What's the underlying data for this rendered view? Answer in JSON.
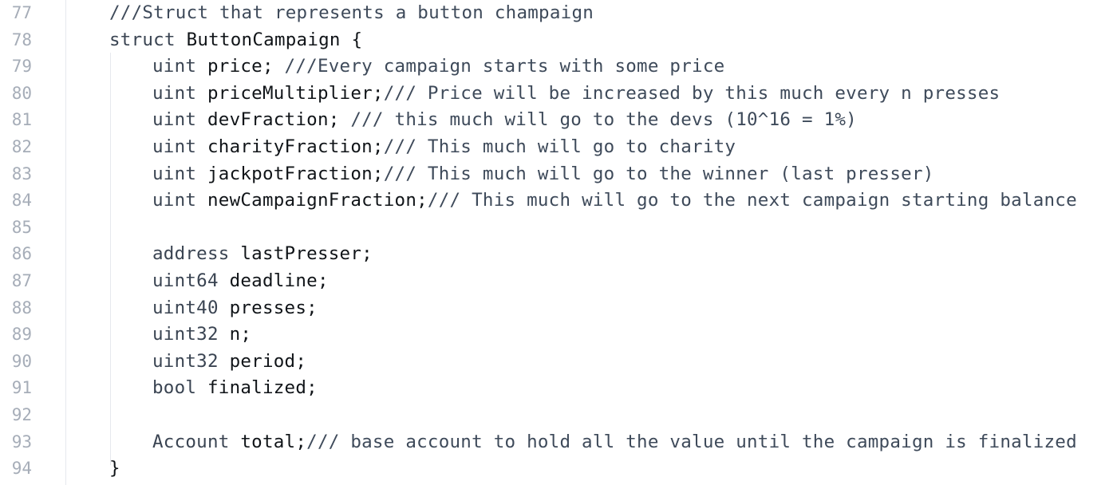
{
  "editor": {
    "lines": [
      {
        "num": "77",
        "indent": 0,
        "type": "",
        "name": "",
        "comment": "///Struct that represents a button champaign"
      },
      {
        "num": "78",
        "indent": 0,
        "type": "struct",
        "name": "ButtonCampaign {",
        "comment": ""
      },
      {
        "num": "79",
        "indent": 1,
        "type": "uint",
        "name": "price;",
        "comment": " ///Every campaign starts with some price"
      },
      {
        "num": "80",
        "indent": 1,
        "type": "uint",
        "name": "priceMultiplier;",
        "comment": "/// Price will be increased by this much every n presses"
      },
      {
        "num": "81",
        "indent": 1,
        "type": "uint",
        "name": "devFraction;",
        "comment": " /// this much will go to the devs (10^16 = 1%)"
      },
      {
        "num": "82",
        "indent": 1,
        "type": "uint",
        "name": "charityFraction;",
        "comment": "/// This much will go to charity"
      },
      {
        "num": "83",
        "indent": 1,
        "type": "uint",
        "name": "jackpotFraction;",
        "comment": "/// This much will go to the winner (last presser)"
      },
      {
        "num": "84",
        "indent": 1,
        "type": "uint",
        "name": "newCampaignFraction;",
        "comment": "/// This much will go to the next campaign starting balance"
      },
      {
        "num": "85",
        "indent": 1,
        "type": "",
        "name": "",
        "comment": ""
      },
      {
        "num": "86",
        "indent": 1,
        "type": "address",
        "name": "lastPresser;",
        "comment": ""
      },
      {
        "num": "87",
        "indent": 1,
        "type": "uint64",
        "name": "deadline;",
        "comment": ""
      },
      {
        "num": "88",
        "indent": 1,
        "type": "uint40",
        "name": "presses;",
        "comment": ""
      },
      {
        "num": "89",
        "indent": 1,
        "type": "uint32",
        "name": "n;",
        "comment": ""
      },
      {
        "num": "90",
        "indent": 1,
        "type": "uint32",
        "name": "period;",
        "comment": ""
      },
      {
        "num": "91",
        "indent": 1,
        "type": "bool",
        "name": "finalized;",
        "comment": ""
      },
      {
        "num": "92",
        "indent": 1,
        "type": "",
        "name": "",
        "comment": ""
      },
      {
        "num": "93",
        "indent": 1,
        "type": "Account",
        "name": "total;",
        "comment": "/// base account to hold all the value until the campaign is finalized"
      },
      {
        "num": "94",
        "indent": 0,
        "type": "",
        "name": "}",
        "comment": ""
      }
    ]
  },
  "colors": {
    "background": "#ffffff",
    "line_number": "#a6adb8",
    "code_text": "#101418",
    "comment": "#3e4a5a",
    "guide": "#e6e8ee"
  }
}
